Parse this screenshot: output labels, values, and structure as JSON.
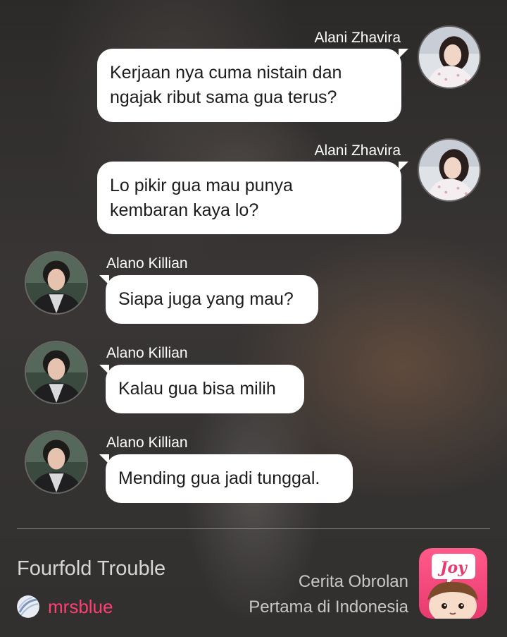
{
  "messages": [
    {
      "sender": "Alani Zhavira",
      "side": "right",
      "lines": [
        "Kerjaan nya cuma nistain dan",
        "ngajak ribut sama gua terus?"
      ]
    },
    {
      "sender": "Alani Zhavira",
      "side": "right",
      "lines": [
        "Lo pikir gua mau punya",
        "kembaran kaya lo?"
      ]
    },
    {
      "sender": "Alano Killian",
      "side": "left",
      "lines": [
        "Siapa juga yang mau?"
      ]
    },
    {
      "sender": "Alano Killian",
      "side": "left",
      "lines": [
        "Kalau gua bisa milih"
      ]
    },
    {
      "sender": "Alano Killian",
      "side": "left",
      "lines": [
        "Mending gua jadi tunggal."
      ]
    }
  ],
  "footer": {
    "story_title": "Fourfold Trouble",
    "author": "mrsblue",
    "tagline_line1": "Cerita Obrolan",
    "tagline_line2": "Pertama di Indonesia",
    "logo_text": "Joy"
  },
  "colors": {
    "bubble": "#ffffff",
    "author_accent": "#ff3f74",
    "logo_pink": "#f0457a"
  },
  "icons": {
    "female_avatar": "avatar-alani-icon",
    "male_avatar": "avatar-alano-icon",
    "author_icon": "author-avatar-icon",
    "app_logo": "joy-logo-icon"
  }
}
